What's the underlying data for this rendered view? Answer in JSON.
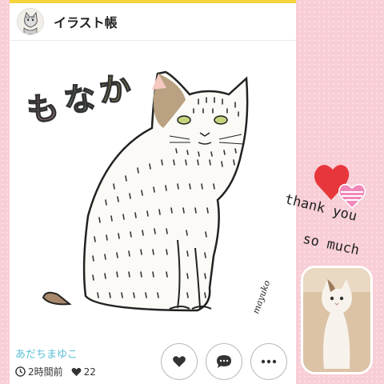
{
  "header": {
    "title": "イラスト帳"
  },
  "artwork": {
    "title_text": "もなか",
    "signature": "mayuko"
  },
  "post": {
    "author": "あだちまゆこ",
    "time": "2時間前",
    "likes": "22"
  },
  "actions": {
    "like": "heart-icon",
    "comment": "speech-bubble-icon",
    "more": "more-icon"
  },
  "side": {
    "line1": "thank you",
    "line2": "so much"
  },
  "colors": {
    "accent": "#f5d33b",
    "author": "#5bbfd6",
    "background": "#f8cdd6",
    "heart": "#e8373c"
  }
}
